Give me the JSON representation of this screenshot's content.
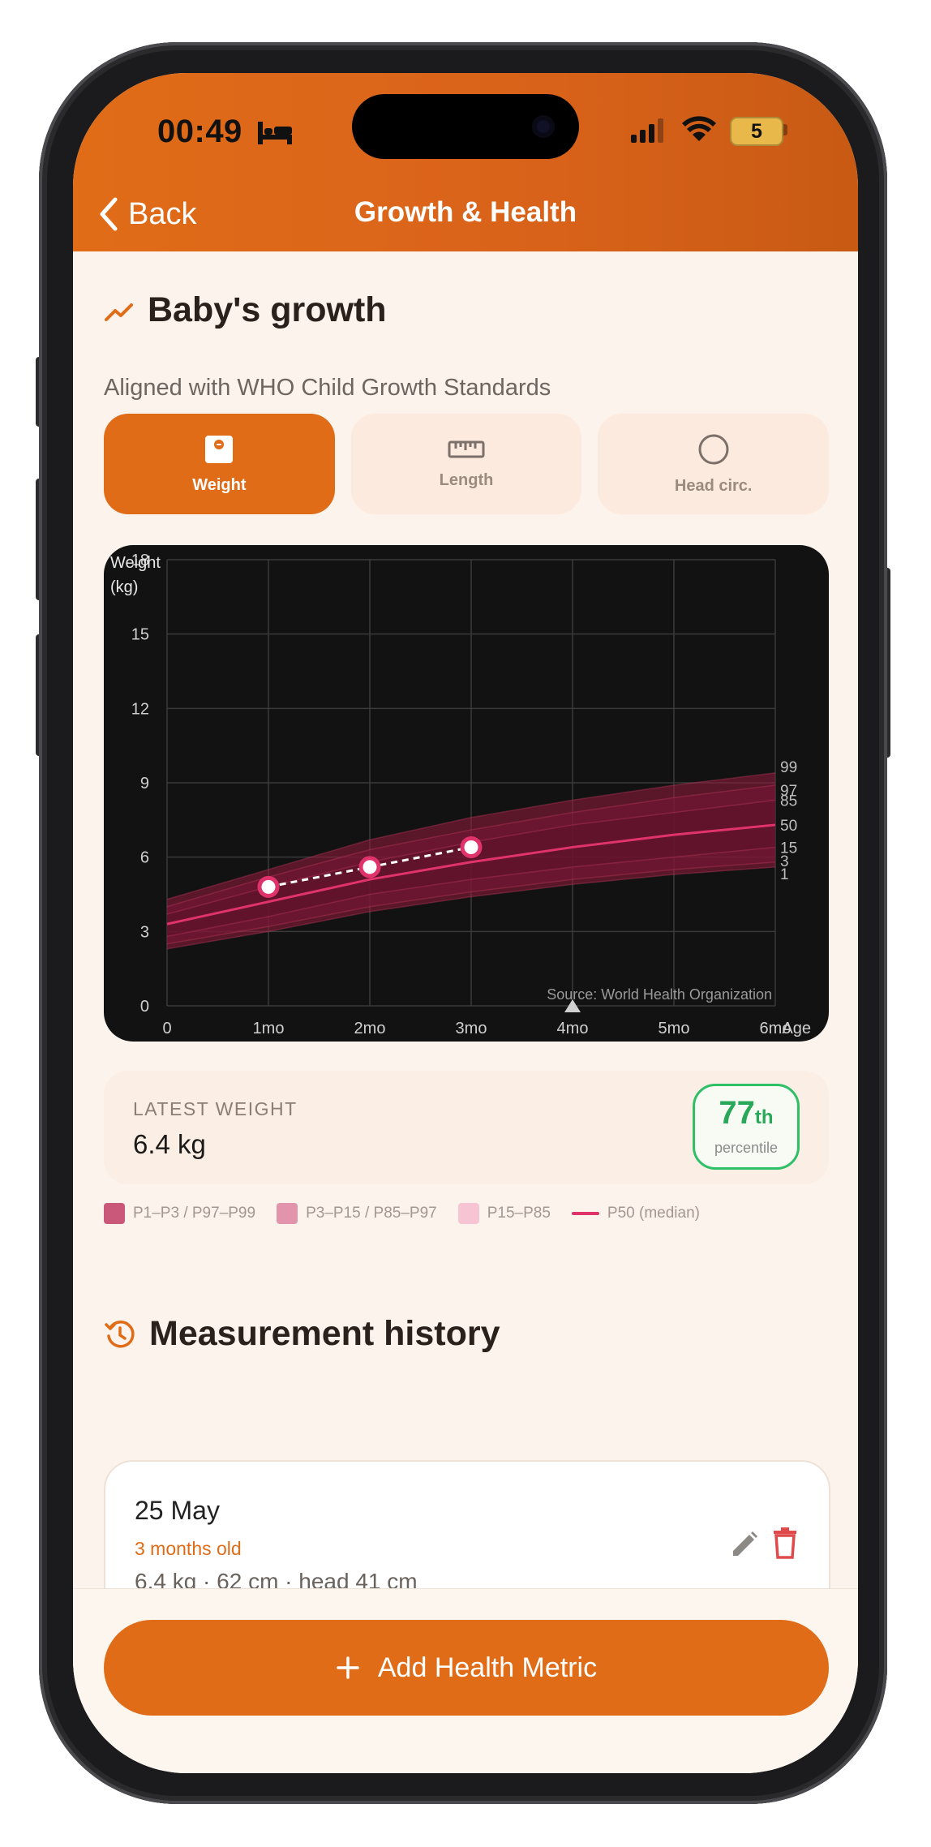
{
  "status_bar": {
    "time": "00:49",
    "battery": "5"
  },
  "nav": {
    "back_label": "Back",
    "title": "Growth & Health"
  },
  "growth": {
    "title": "Baby's growth",
    "subtitle": "Aligned with WHO Child Growth Standards",
    "tabs": [
      {
        "label": "Weight",
        "active": true,
        "icon": "scale-icon"
      },
      {
        "label": "Length",
        "active": false,
        "icon": "ruler-icon"
      },
      {
        "label": "Head circ.",
        "active": false,
        "icon": "circle-icon"
      }
    ]
  },
  "chart_data": {
    "type": "line",
    "ylabel": "Weight (kg)",
    "ylabel_lines": [
      "Weight",
      "(kg)"
    ],
    "xlabel": "Age",
    "x_ticks": [
      "0",
      "1mo",
      "2mo",
      "3mo",
      "4mo",
      "5mo",
      "6mo"
    ],
    "y_ticks": [
      "0",
      "3",
      "6",
      "9",
      "12",
      "15",
      "18"
    ],
    "ylim": [
      0,
      18
    ],
    "xlim": [
      0,
      6
    ],
    "grid": true,
    "source": "Source: World Health Organization",
    "current_age_marker": 4,
    "percentile_curves": [
      {
        "name": "1",
        "values": [
          2.3,
          3.0,
          3.8,
          4.4,
          4.9,
          5.3,
          5.6
        ]
      },
      {
        "name": "3",
        "values": [
          2.5,
          3.2,
          4.0,
          4.6,
          5.1,
          5.5,
          5.8
        ]
      },
      {
        "name": "15",
        "values": [
          2.8,
          3.6,
          4.5,
          5.1,
          5.6,
          6.0,
          6.4
        ]
      },
      {
        "name": "50",
        "values": [
          3.3,
          4.2,
          5.1,
          5.8,
          6.4,
          6.9,
          7.3
        ]
      },
      {
        "name": "85",
        "values": [
          3.7,
          4.8,
          5.8,
          6.6,
          7.3,
          7.8,
          8.3
        ]
      },
      {
        "name": "97",
        "values": [
          4.0,
          5.2,
          6.3,
          7.1,
          7.8,
          8.4,
          8.9
        ]
      },
      {
        "name": "99",
        "values": [
          4.3,
          5.5,
          6.7,
          7.6,
          8.3,
          8.9,
          9.4
        ]
      }
    ],
    "measurements": [
      {
        "x": 1,
        "y": 4.8
      },
      {
        "x": 2,
        "y": 5.6
      },
      {
        "x": 3,
        "y": 6.4
      }
    ]
  },
  "latest": {
    "label": "LATEST WEIGHT",
    "value": "6.4 kg",
    "percentile": "77",
    "percentile_suffix": "th",
    "percentile_word": "percentile"
  },
  "legend": [
    {
      "label": "P1–P3 / P97–P99",
      "color": "#c9587a"
    },
    {
      "label": "P3–P15 / P85–P97",
      "color": "#e394ad"
    },
    {
      "label": "P15–P85",
      "color": "#f7c4d3"
    },
    {
      "label": "P50 (median)",
      "color": "#e0336c"
    }
  ],
  "history": {
    "title": "Measurement history",
    "items": [
      {
        "date": "25 May",
        "age": "3 months old",
        "details": "6.4 kg · 62 cm · head 41 cm"
      }
    ]
  },
  "footer": {
    "add_label": "Add Health Metric"
  },
  "colors": {
    "accent": "#e06c18",
    "median": "#e0336c",
    "success": "#2fbf66"
  }
}
